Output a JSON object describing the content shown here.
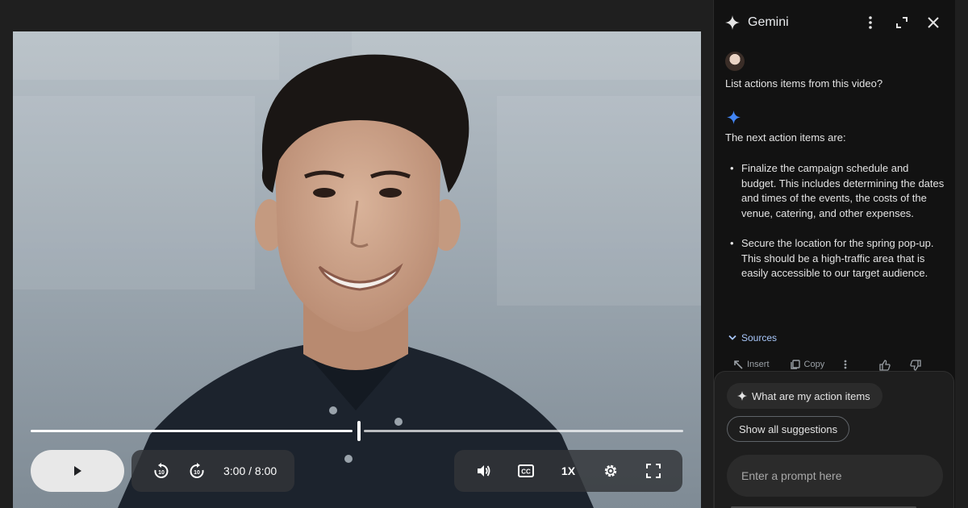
{
  "video": {
    "time_display": "3:00 / 8:00",
    "progress_fraction": 0.5,
    "speed_label": "1X",
    "rewind_label": "10",
    "forward_label": "10"
  },
  "gemini": {
    "title": "Gemini",
    "user_message": "List actions items from this video?",
    "response_intro": "The next action items are:",
    "bullets": [
      "Finalize the campaign schedule and budget. This includes determining the dates and times of the events, the costs of the venue, catering, and other expenses.",
      "Secure the location for the spring pop-up. This should be a high-traffic area that is easily accessible to our target audience."
    ],
    "sources_label": "Sources",
    "actions": {
      "insert_label": "Insert",
      "copy_label": "Copy"
    },
    "suggestion_chip": "What are my action items",
    "show_all_label": "Show all suggestions",
    "prompt_placeholder": "Enter a prompt here"
  },
  "colors": {
    "background": "#1f1f1f",
    "panel": "#121212",
    "accent_blue": "#4285f4",
    "link": "#a8c7fa"
  }
}
